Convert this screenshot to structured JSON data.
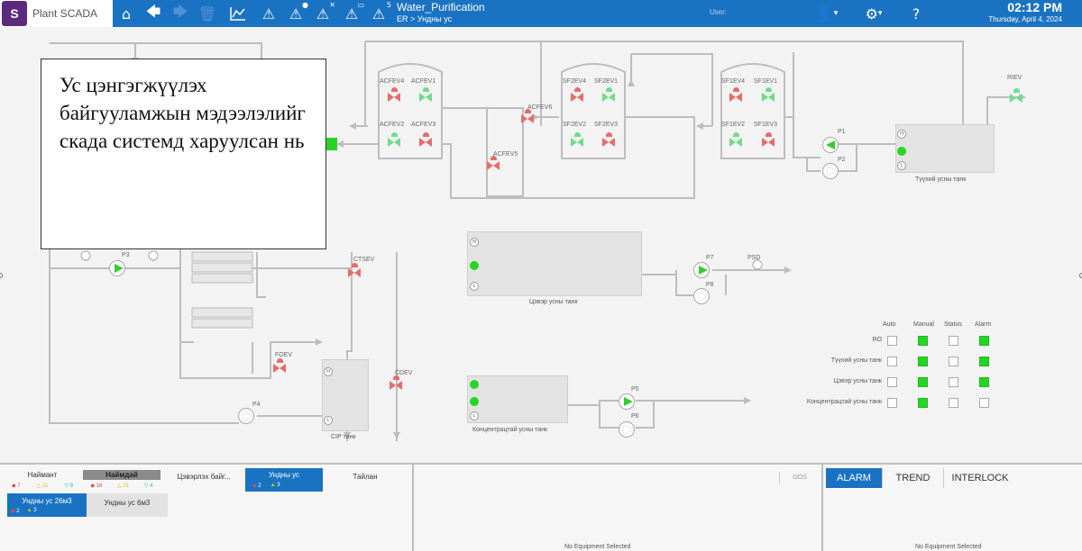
{
  "header": {
    "app_name": "Plant SCADA",
    "logo_glyph": "S",
    "title": "Water_Purification",
    "breadcrumb": "ER > Ундны ус",
    "user_label": "User:",
    "time": "02:12 PM",
    "date": "Thursday, April 4, 2024",
    "toolbar_icons": [
      "home-icon",
      "back-arrow-icon",
      "forward-arrow-icon",
      "trash-icon",
      "trend-chart-icon",
      "alarm-icon",
      "alarm-acknowledge-icon",
      "alarm-silence-icon",
      "alarm-display-icon",
      "alarm-count-icon",
      "user-icon",
      "gear-icon",
      "help-icon"
    ],
    "alarm_count_badge": "5"
  },
  "callout": {
    "text": "Ус цэнгэгжүүлэх байгууламжын мэдээлэлийг скада системд харуулсан нь"
  },
  "diagram": {
    "valves": {
      "acfev4": "ACFEV4",
      "acfev1": "ACFEV1",
      "acfev2": "ACFEV2",
      "acfev3": "ACFEV3",
      "acfev6": "ACFEV6",
      "acfev5": "ACFEV5",
      "sf2ev4": "SF2EV4",
      "sf2ev1": "SF2EV1",
      "sf2ev2": "SF2EV2",
      "sf2ev3": "SF2EV3",
      "sf1ev4": "SF1EV4",
      "sf1ev1": "SF1EV1",
      "sf1ev2": "SF1EV2",
      "sf1ev3": "SF1EV3",
      "riev": "RIEV",
      "ctsev": "CTSEV",
      "foev": "FOEV",
      "cdev": "CDEV"
    },
    "pumps": {
      "p1": "P1",
      "p2": "P2",
      "p3": "P3",
      "p4": "P4",
      "p5": "P5",
      "p6": "P6",
      "p7": "P7",
      "p8": "P8"
    },
    "psd": "PSD",
    "tanks": {
      "raw": "Түүхий усны танк",
      "clean": "Цэвэр усны танк",
      "concentrate": "Концентрацтай усны танк",
      "cip": "CIP танк"
    },
    "indicator_letters": {
      "high": "H",
      "low": "L"
    }
  },
  "status_matrix": {
    "columns": [
      "Auto",
      "Manual",
      "Status",
      "Alarm"
    ],
    "rows": [
      {
        "name": "RO",
        "cells": [
          false,
          true,
          false,
          true
        ]
      },
      {
        "name": "Түүхий усны танк",
        "cells": [
          false,
          true,
          false,
          true
        ]
      },
      {
        "name": "Цэвэр усны танк",
        "cells": [
          false,
          true,
          false,
          true
        ]
      },
      {
        "name": "Концентрацтай усны танк",
        "cells": [
          false,
          true,
          false,
          false
        ]
      }
    ]
  },
  "bottom": {
    "equipment_tabs": [
      {
        "label": "Наймант",
        "red": "7",
        "yellow": "21",
        "cyan": "9"
      },
      {
        "label": "Наймдай",
        "red": "16",
        "yellow": "21",
        "cyan": "4"
      },
      {
        "label": "Цэвэрлэх байг..."
      },
      {
        "label": "Ундны ус",
        "red": "2",
        "yellow": "3"
      },
      {
        "label": "Тайлан"
      }
    ],
    "sub_tabs": [
      {
        "label": "Ундны ус 26м3",
        "red": "2",
        "yellow": "3"
      },
      {
        "label": "Ундны ус 6м3"
      }
    ],
    "oos_label": "OOS",
    "no_equipment": "No Equipment Selected",
    "right_tabs": [
      "ALARM",
      "TREND",
      "INTERLOCK"
    ]
  },
  "colors": {
    "header_blue": "#1a73c2",
    "run_green": "#23d623",
    "valve_closed_red": "#e86a6a",
    "valve_open_green": "#6fdc8c",
    "pipe_gray": "#bdbdbd"
  }
}
